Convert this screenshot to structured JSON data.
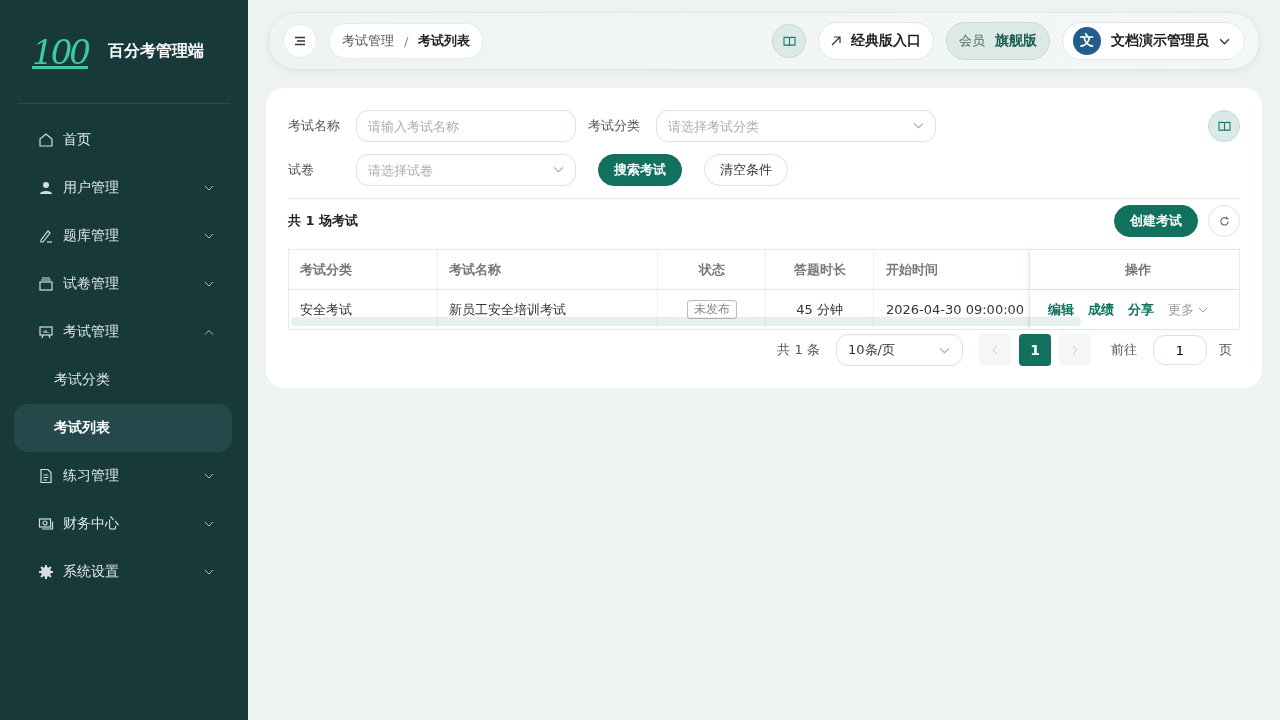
{
  "sidebar": {
    "brand_logo": "100",
    "brand_name": "百分考管理端",
    "items": [
      {
        "label": "首页"
      },
      {
        "label": "用户管理",
        "expanded": false
      },
      {
        "label": "题库管理",
        "expanded": false
      },
      {
        "label": "试卷管理",
        "expanded": false
      },
      {
        "label": "考试管理",
        "expanded": true,
        "children": [
          {
            "label": "考试分类",
            "selected": false
          },
          {
            "label": "考试列表",
            "selected": true
          }
        ]
      },
      {
        "label": "练习管理",
        "expanded": false
      },
      {
        "label": "财务中心",
        "expanded": false
      },
      {
        "label": "系统设置",
        "expanded": false
      }
    ]
  },
  "header": {
    "breadcrumb": [
      "考试管理",
      "考试列表"
    ],
    "breadcrumb_separator": "/",
    "classic_link": "经典版入口",
    "member_label": "会员",
    "member_plan": "旗舰版",
    "user_initial": "文",
    "user_name": "文档演示管理员"
  },
  "filters": [
    {
      "label": "考试名称",
      "placeholder": "请输入考试名称",
      "kind": "input"
    },
    {
      "label": "考试分类",
      "placeholder": "请选择考试分类",
      "kind": "select"
    },
    {
      "label": "试卷",
      "placeholder": "请选择试卷",
      "kind": "select"
    }
  ],
  "search_button": "搜索考试",
  "clear_button": "清空条件",
  "summary": "共 1 场考试",
  "create_button": "创建考试",
  "table": {
    "columns": [
      "考试分类",
      "考试名称",
      "状态",
      "答题时长",
      "开始时间",
      "操作"
    ],
    "rows": [
      {
        "category": "安全考试",
        "name": "新员工安全培训考试",
        "status": "未发布",
        "duration": "45 分钟",
        "start": "2026-04-30 09:00:00",
        "actions": [
          {
            "label": "编辑",
            "kind": "link"
          },
          {
            "label": "成绩",
            "kind": "link"
          },
          {
            "label": "分享",
            "kind": "link"
          },
          {
            "label": "更多",
            "kind": "dropdown"
          }
        ]
      }
    ]
  },
  "pagination": {
    "total": "共 1 条",
    "page_size": "10条/页",
    "prev_disabled": true,
    "next_disabled": true,
    "pages": [
      {
        "label": "1",
        "selected": true
      }
    ],
    "goto_label": "前往",
    "goto_value": "1",
    "goto_suffix": "页"
  }
}
